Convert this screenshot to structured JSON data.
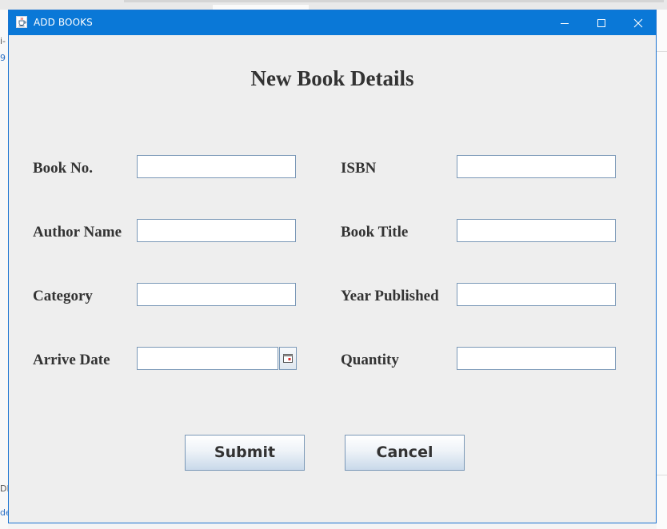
{
  "background": {
    "left_fragments": [
      "i-",
      "9",
      "DB",
      "de"
    ]
  },
  "window": {
    "title": "ADD BOOKS",
    "icon": "java-coffee-icon",
    "controls": [
      "minimize-icon",
      "maximize-icon",
      "close-icon"
    ],
    "accent_color": "#0a78d7"
  },
  "form": {
    "heading": "New Book Details",
    "left": {
      "book_no": {
        "label": "Book No.",
        "value": ""
      },
      "author_name": {
        "label": "Author Name",
        "value": ""
      },
      "category": {
        "label": "Category",
        "value": ""
      },
      "arrive_date": {
        "label": "Arrive Date",
        "value": "",
        "picker_icon": "calendar-icon"
      }
    },
    "right": {
      "isbn": {
        "label": "ISBN",
        "value": ""
      },
      "book_title": {
        "label": "Book Title",
        "value": ""
      },
      "year_published": {
        "label": "Year Published",
        "value": ""
      },
      "quantity": {
        "label": "Quantity",
        "value": ""
      }
    }
  },
  "buttons": {
    "submit": "Submit",
    "cancel": "Cancel"
  }
}
